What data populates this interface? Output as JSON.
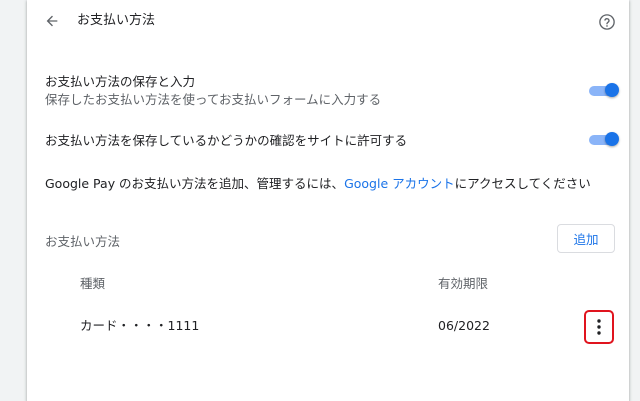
{
  "header": {
    "title": "お支払い方法",
    "back_icon": "arrow-back-icon",
    "help_icon": "help-circle-icon"
  },
  "settings": {
    "save_and_fill": {
      "title": "お支払い方法の保存と入力",
      "subtitle": "保存したお支払い方法を使ってお支払いフォームに入力する",
      "enabled": true
    },
    "allow_check": {
      "title": "お支払い方法を保存しているかどうかの確認をサイトに許可する",
      "enabled": true
    }
  },
  "google_pay": {
    "prefix": "Google Pay のお支払い方法を追加、管理するには、",
    "link": "Google アカウント",
    "suffix": "にアクセスしてください"
  },
  "payment_methods": {
    "label": "お支払い方法",
    "add_label": "追加",
    "columns": [
      "種類",
      "有効期限"
    ],
    "rows": [
      {
        "type": "カード・・・・1111",
        "expiry": "06/2022"
      }
    ]
  },
  "colors": {
    "accent": "#1a73e8",
    "toggle_track": "#8ab4f8",
    "highlight": "#e0141e"
  }
}
